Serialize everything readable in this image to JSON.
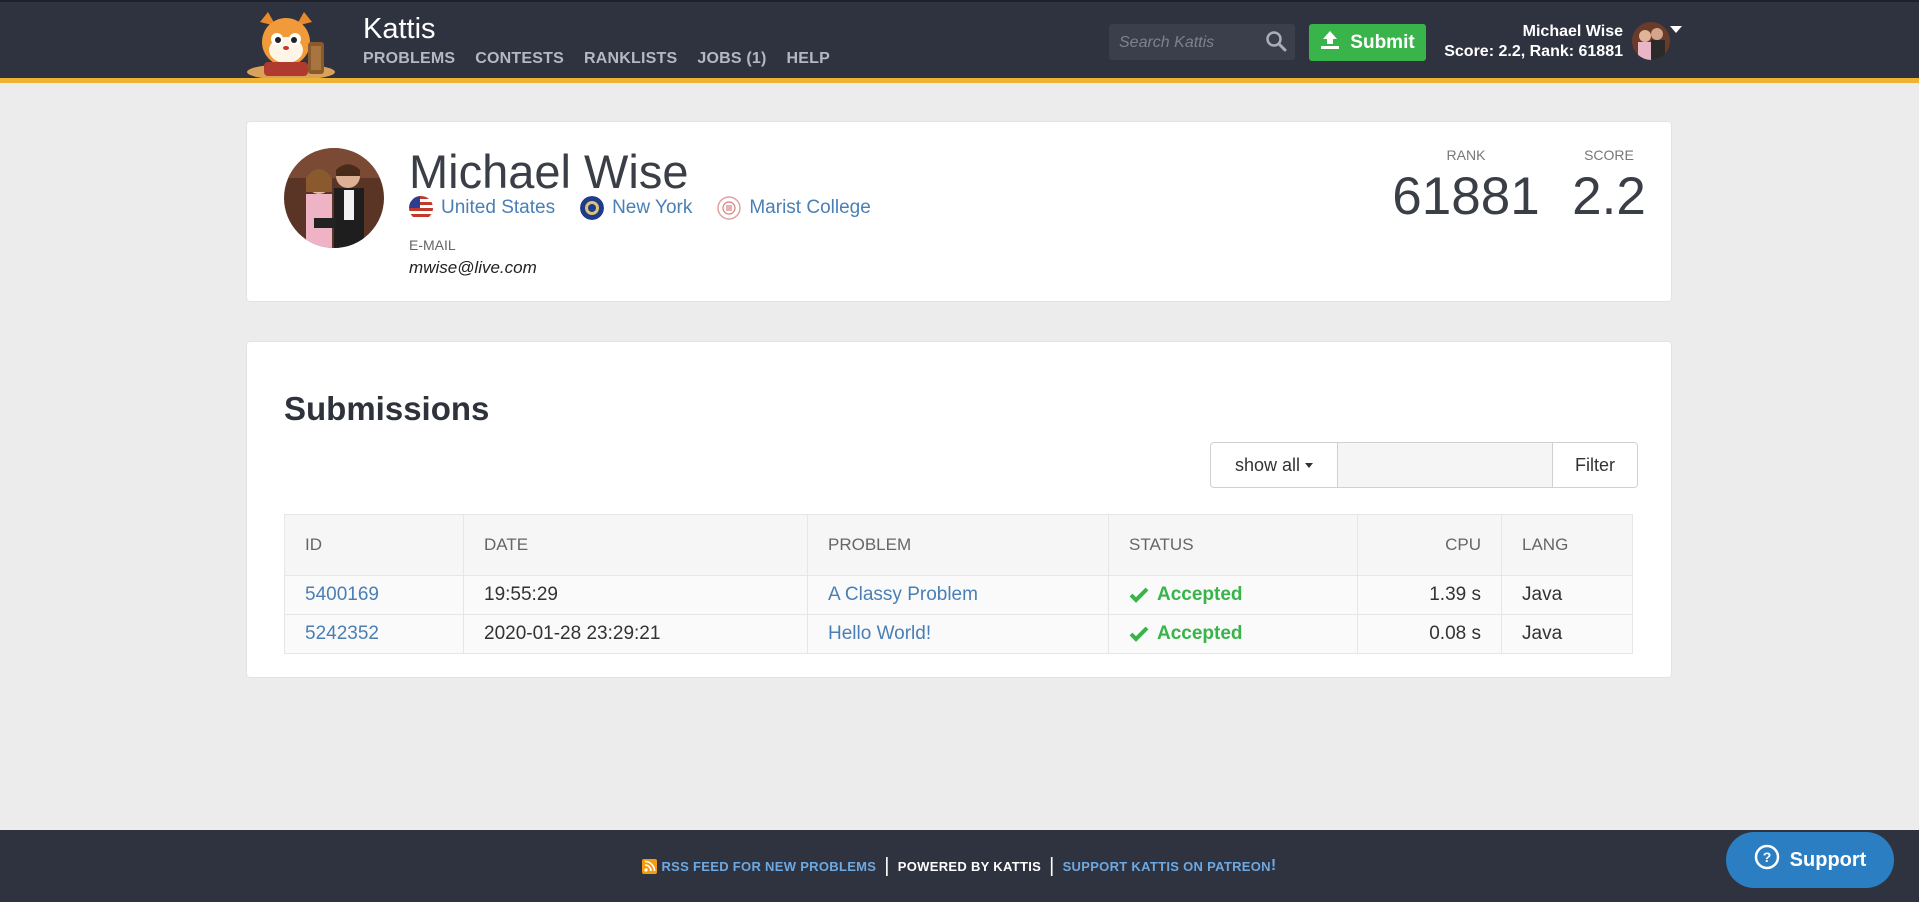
{
  "header": {
    "brand": "Kattis",
    "nav": [
      "PROBLEMS",
      "CONTESTS",
      "RANKLISTS",
      "JOBS (1)",
      "HELP"
    ],
    "search_placeholder": "Search Kattis",
    "submit_label": "Submit",
    "user_name": "Michael Wise",
    "user_stats": "Score: 2.2, Rank: 61881",
    "accent_color": "#f0b232",
    "bar_color": "#2f3340"
  },
  "profile": {
    "name": "Michael Wise",
    "country": "United States",
    "state": "New York",
    "school": "Marist College",
    "email_label": "E-MAIL",
    "email": "mwise@live.com",
    "rank_label": "RANK",
    "rank": "61881",
    "score_label": "SCORE",
    "score": "2.2"
  },
  "submissions": {
    "title": "Submissions",
    "filter_select": "show all",
    "filter_button": "Filter",
    "columns": [
      "ID",
      "DATE",
      "PROBLEM",
      "STATUS",
      "CPU",
      "LANG"
    ],
    "rows": [
      {
        "id": "5400169",
        "date": "19:55:29",
        "problem": "A Classy Problem",
        "status": "Accepted",
        "cpu": "1.39 s",
        "lang": "Java"
      },
      {
        "id": "5242352",
        "date": "2020-01-28 23:29:21",
        "problem": "Hello World!",
        "status": "Accepted",
        "cpu": "0.08 s",
        "lang": "Java"
      }
    ],
    "accepted_color": "#38b44a"
  },
  "footer": {
    "rss": "RSS FEED FOR NEW PROBLEMS",
    "powered": "POWERED BY KATTIS",
    "patreon": "SUPPORT KATTIS ON PATREON",
    "patreon_suffix": "!",
    "support_label": "Support"
  }
}
